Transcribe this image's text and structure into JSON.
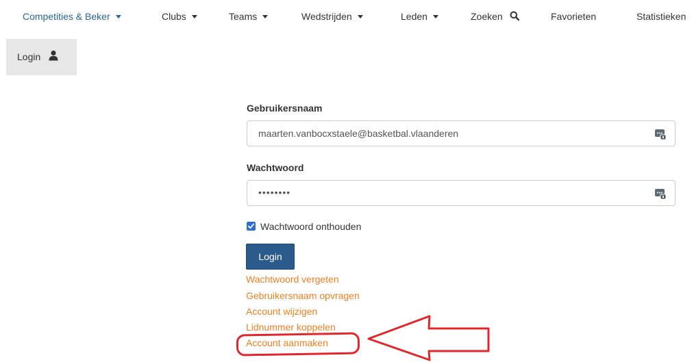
{
  "nav": {
    "items": [
      {
        "label": "Competities & Beker",
        "dropdown": true,
        "active": true
      },
      {
        "label": "Clubs",
        "dropdown": true,
        "active": false
      },
      {
        "label": "Teams",
        "dropdown": true,
        "active": false
      },
      {
        "label": "Wedstrijden",
        "dropdown": true,
        "active": false
      },
      {
        "label": "Leden",
        "dropdown": true,
        "active": false
      },
      {
        "label": "Zoeken",
        "dropdown": false,
        "icon": "search-icon"
      },
      {
        "label": "Favorieten",
        "dropdown": false
      },
      {
        "label": "Statistieken",
        "dropdown": false
      }
    ],
    "login_tab": {
      "label": "Login",
      "icon": "user-icon"
    }
  },
  "form": {
    "username_label": "Gebruikersnaam",
    "username_value": "maarten.vanbocxstaele@basketbal.vlaanderen",
    "password_label": "Wachtwoord",
    "password_value": "••••••••",
    "remember_label": "Wachtwoord onthouden",
    "remember_checked": true,
    "login_button": "Login",
    "field_icon": "password-manager-icon"
  },
  "links": [
    "Wachtwoord vergeten",
    "Gebruikersnaam opvragen",
    "Account wijzigen",
    "Lidnummer koppelen",
    "Account aanmaken"
  ],
  "colors": {
    "nav_active": "#2a6496",
    "link": "#f07f1f",
    "button": "#2a5b8c",
    "annotation": "#e3262b",
    "login_tab_bg": "#e7e7e7"
  }
}
